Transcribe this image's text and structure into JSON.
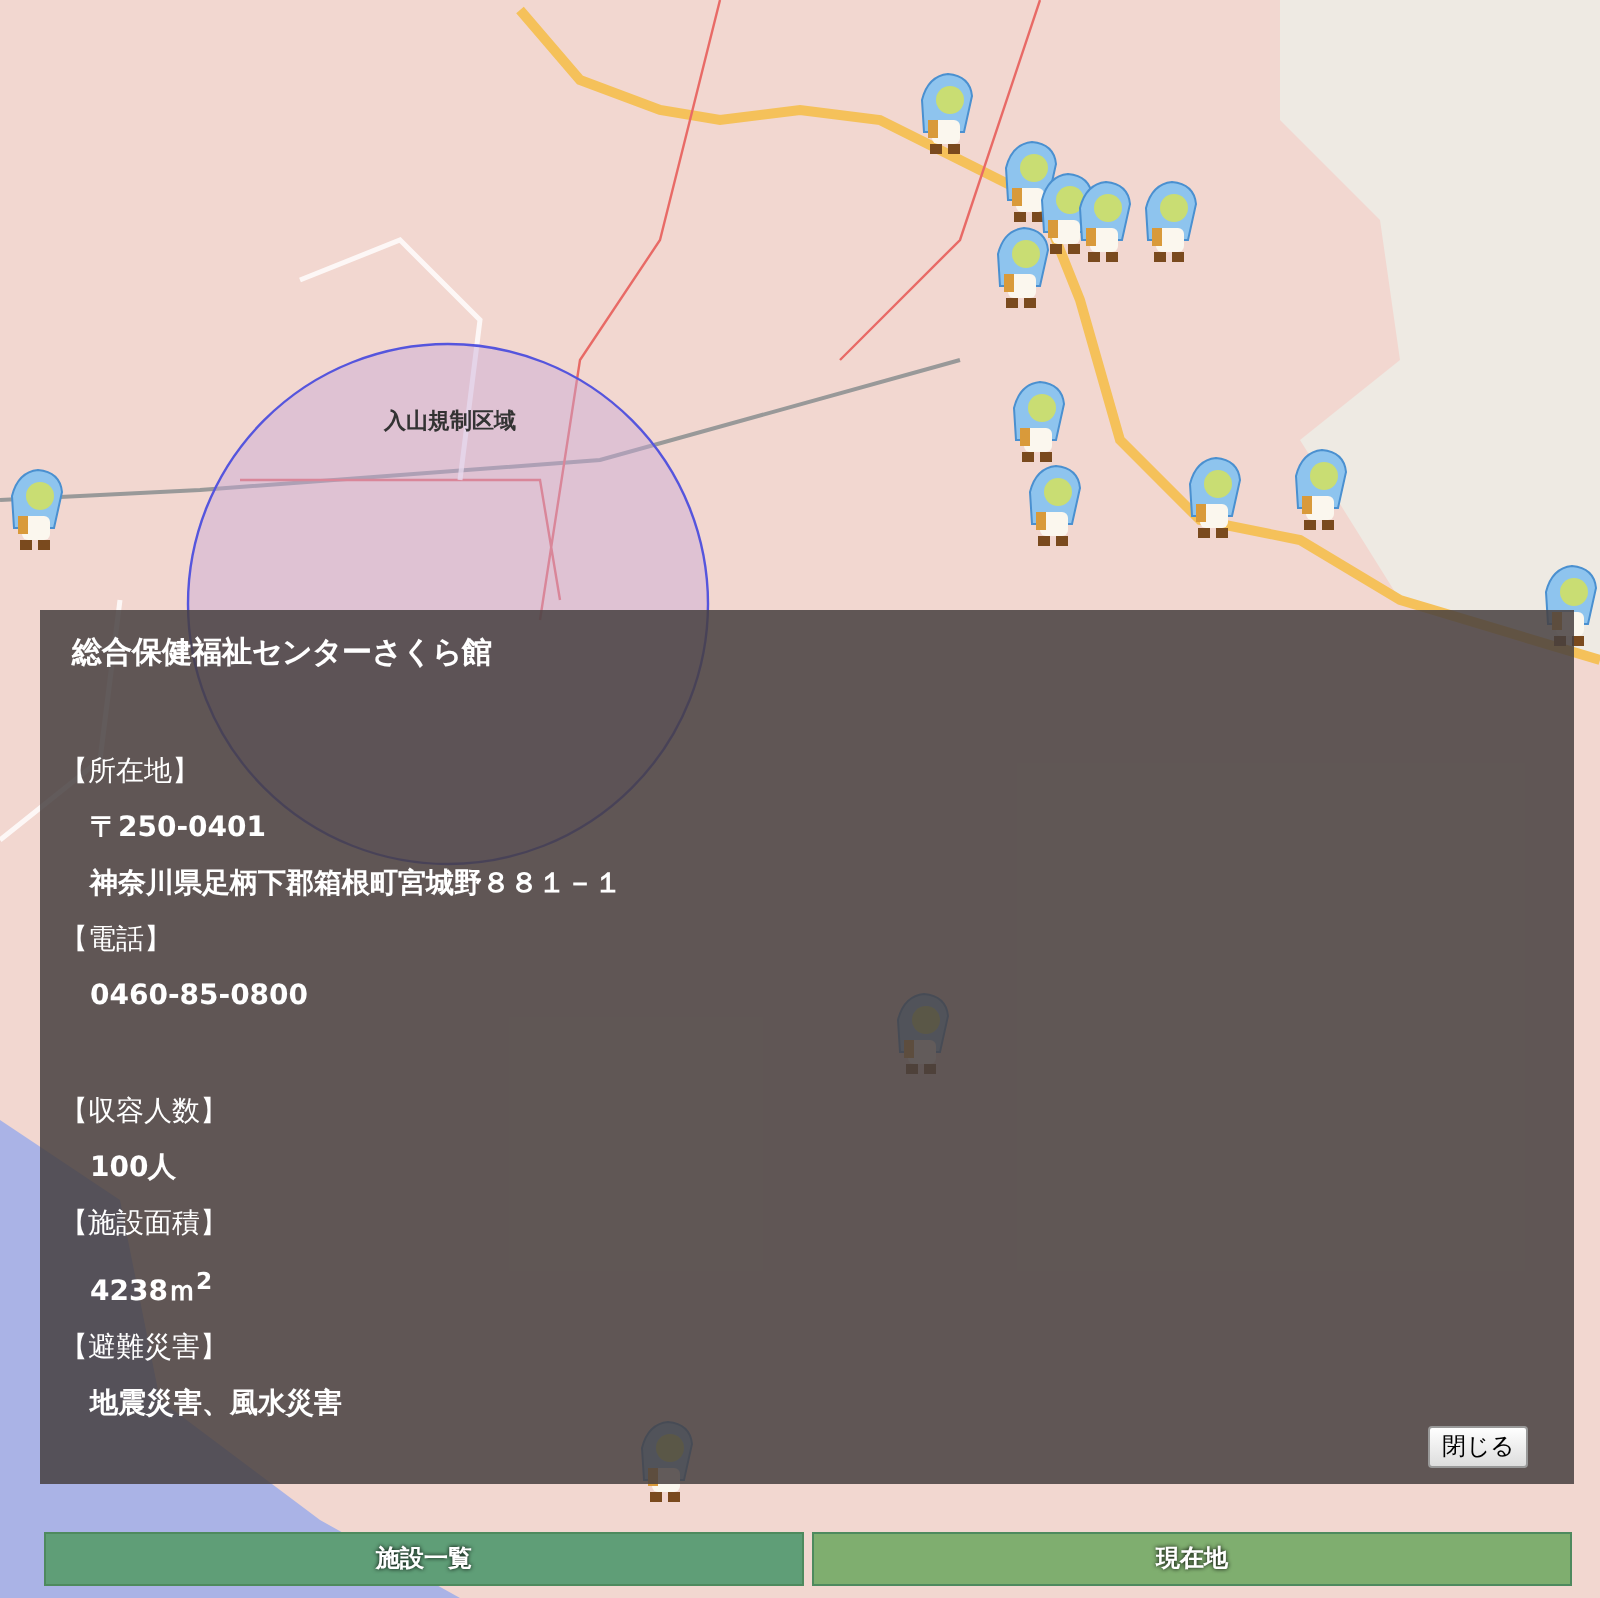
{
  "map": {
    "zone_label": "入山規制区域"
  },
  "popup": {
    "title": "総合保健福祉センターさくら館",
    "sections": [
      {
        "heading": "【所在地】",
        "lines": [
          "〒250-0401",
          "神奈川県足柄下郡箱根町宮城野８８１－１"
        ]
      },
      {
        "heading": "【電話】",
        "lines": [
          "0460-85-0800"
        ]
      },
      {
        "heading": "【収容人数】",
        "lines": [
          "100人"
        ]
      },
      {
        "heading": "【施設面積】",
        "lines": [
          "4238ｍ$^{2}$"
        ]
      },
      {
        "heading": "【避難災害】",
        "lines": [
          "地震災害、風水災害"
        ]
      }
    ],
    "close_button": "閉じる"
  },
  "buttons": [
    "施設一覧",
    "現在地"
  ]
}
